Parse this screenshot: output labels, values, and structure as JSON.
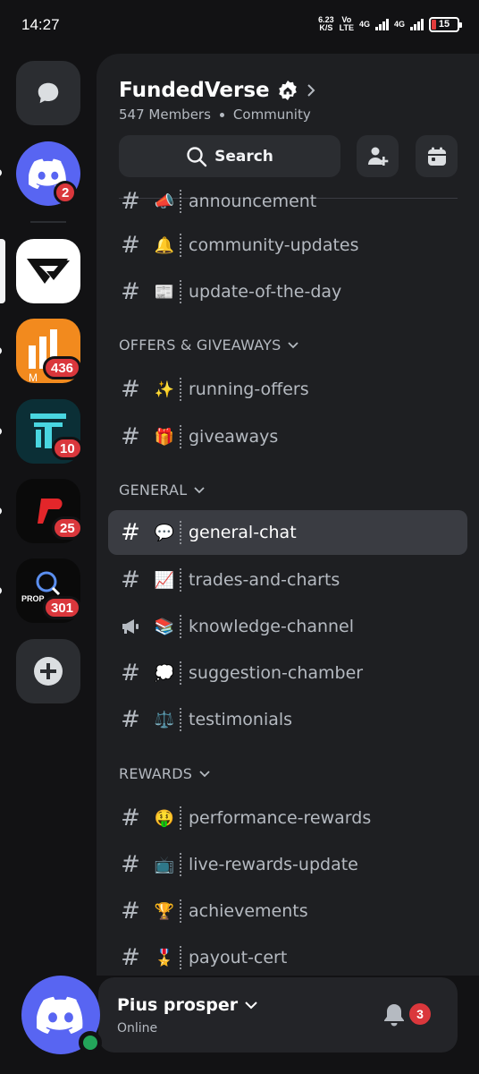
{
  "status_bar": {
    "time": "14:27",
    "net_speed_value": "6.23",
    "net_speed_unit": "K/S",
    "volte_top": "Vo",
    "volte_bottom": "LTE",
    "sim1": "4G",
    "sim2": "4G",
    "battery": "15"
  },
  "servers": [
    {
      "name": "Direct Messages",
      "icon": "chat-bubble-icon",
      "badge": ""
    },
    {
      "name": "Discord Home",
      "icon": "discord-logo-icon",
      "badge": "2"
    },
    {
      "name": "FundedVerse",
      "icon": "fundedverse-logo",
      "badge": ""
    },
    {
      "name": "M Server",
      "icon": "orange-m-logo",
      "badge": "436"
    },
    {
      "name": "Teal Server",
      "icon": "teal-t-logo",
      "badge": "10"
    },
    {
      "name": "P Server",
      "icon": "red-p-logo",
      "badge": "25"
    },
    {
      "name": "Prop Server",
      "icon": "prop-magnifier-logo",
      "badge": "301",
      "label": "PROP"
    },
    {
      "name": "Add a Server",
      "icon": "plus-icon",
      "badge": ""
    }
  ],
  "server_header": {
    "name": "FundedVerse",
    "members": "547 Members",
    "type": "Community",
    "search_label": "Search"
  },
  "channels_top": [
    {
      "name": "announcement",
      "emoji": "📣",
      "icon": "hash-icon"
    },
    {
      "name": "community-updates",
      "emoji": "🔔",
      "icon": "hash-icon"
    },
    {
      "name": "update-of-the-day",
      "emoji": "📰",
      "icon": "hash-icon"
    }
  ],
  "categories": [
    {
      "name": "OFFERS & GIVEAWAYS",
      "channels": [
        {
          "name": "running-offers",
          "emoji": "✨",
          "icon": "hash-icon"
        },
        {
          "name": "giveaways",
          "emoji": "🎁",
          "icon": "hash-icon"
        }
      ]
    },
    {
      "name": "GENERAL",
      "channels": [
        {
          "name": "general-chat",
          "emoji": "💬",
          "icon": "hash-icon",
          "active": true
        },
        {
          "name": "trades-and-charts",
          "emoji": "📈",
          "icon": "hash-icon"
        },
        {
          "name": "knowledge-channel",
          "emoji": "📚",
          "icon": "megaphone-icon"
        },
        {
          "name": "suggestion-chamber",
          "emoji": "💭",
          "icon": "hash-icon"
        },
        {
          "name": "testimonials",
          "emoji": "⚖️",
          "icon": "hash-icon"
        }
      ]
    },
    {
      "name": "REWARDS",
      "channels": [
        {
          "name": "performance-rewards",
          "emoji": "🤑",
          "icon": "hash-icon"
        },
        {
          "name": "live-rewards-update",
          "emoji": "📺",
          "icon": "hash-icon"
        },
        {
          "name": "achievements",
          "emoji": "🏆",
          "icon": "hash-icon"
        },
        {
          "name": "payout-cert",
          "emoji": "🎖️",
          "icon": "hash-icon"
        }
      ]
    }
  ],
  "user": {
    "name": "Pius prosper",
    "status": "Online",
    "notifications": "3"
  },
  "colors": {
    "background": "#121214",
    "panel": "#1e1f22",
    "blurple": "#5865f2",
    "badge_red": "#da373c",
    "online_green": "#23a55a",
    "active_row": "#3a3c42"
  }
}
